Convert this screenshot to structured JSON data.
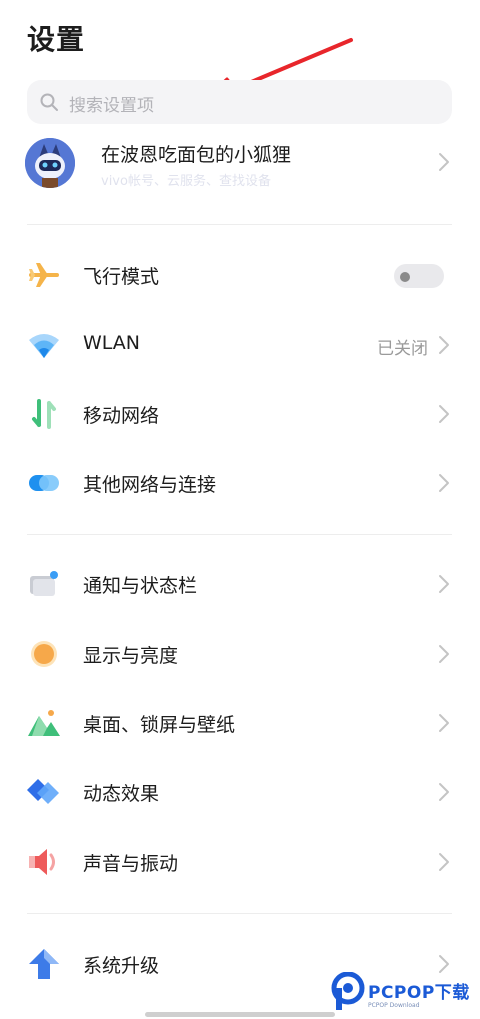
{
  "page": {
    "title": "设置"
  },
  "search": {
    "placeholder": "搜索设置项"
  },
  "account": {
    "name": "在波恩吃面包的小狐狸",
    "subtitle": "vivo帐号、云服务、查找设备"
  },
  "sections": [
    {
      "items": [
        {
          "label": "飞行模式",
          "icon": "airplane-icon",
          "control": "toggle",
          "toggle_on": false
        },
        {
          "label": "WLAN",
          "icon": "wifi-icon",
          "value": "已关闭"
        },
        {
          "label": "移动网络",
          "icon": "mobile-network-icon"
        },
        {
          "label": "其他网络与连接",
          "icon": "connections-icon"
        }
      ]
    },
    {
      "items": [
        {
          "label": "通知与状态栏",
          "icon": "notification-icon"
        },
        {
          "label": "显示与亮度",
          "icon": "brightness-icon"
        },
        {
          "label": "桌面、锁屏与壁纸",
          "icon": "wallpaper-icon"
        },
        {
          "label": "动态效果",
          "icon": "dynamic-effects-icon"
        },
        {
          "label": "声音与振动",
          "icon": "sound-icon"
        }
      ]
    },
    {
      "items": [
        {
          "label": "系统升级",
          "icon": "system-upgrade-icon"
        }
      ]
    }
  ],
  "watermark": {
    "brand": "PCPOP下载",
    "sub": "PCPOP Download"
  },
  "colors": {
    "annotation_arrow": "#e8262b",
    "airplane": "#f5b44a",
    "wifi": "#3a9df5",
    "mobile": "#3fbf7a",
    "connections": "#1e90ef",
    "brightness": "#f6a84a",
    "dynamic": "#2f6ee8",
    "sound": "#ee5a5a",
    "upgrade": "#3d7be8",
    "watermark": "#1b5ad6"
  }
}
